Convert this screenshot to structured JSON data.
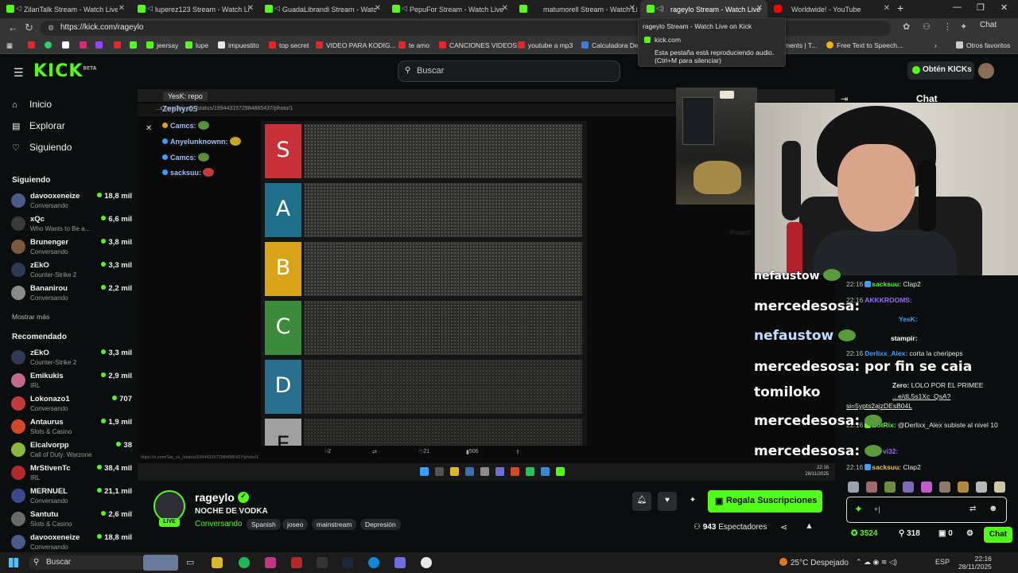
{
  "browser": {
    "tabs": [
      {
        "title": "ZilanTalk Stream - Watch Live",
        "favicon": "kick-icon",
        "muted": true
      },
      {
        "title": "luperez123 Stream - Watch Live",
        "favicon": "kick-icon",
        "muted": true
      },
      {
        "title": "GuadaLibrandi Stream - Watch Live",
        "favicon": "kick-icon",
        "muted": true
      },
      {
        "title": "PepuFor Stream - Watch Live",
        "favicon": "kick-icon",
        "muted": true
      },
      {
        "title": "matumorell Stream - Watch Live",
        "favicon": "kick-icon",
        "muted": false
      },
      {
        "title": "rageylo Stream - Watch Live",
        "favicon": "kick-icon",
        "muted": false,
        "active": true
      },
      {
        "title": "Worldwide! - YouTube",
        "favicon": "youtube-icon",
        "muted": false
      }
    ],
    "url": "https://kick.com/rageylo",
    "chat_button": "Chat",
    "bookmarks": [
      {
        "label": "jeersay",
        "color": "#53fc18"
      },
      {
        "label": "lupe",
        "color": "#53fc18"
      },
      {
        "label": "impuestito",
        "color": "#e6e6e6"
      },
      {
        "label": "top secret",
        "color": "#e8232a"
      },
      {
        "label": "VIDEO PARA KODIG...",
        "color": "#e8232a"
      },
      {
        "label": "te amo",
        "color": "#e8232a"
      },
      {
        "label": "CANCIONES VIDEOS",
        "color": "#e8232a"
      },
      {
        "label": "youtube a mp3",
        "color": "#e8232a"
      },
      {
        "label": "Calculadora De",
        "color": "#3b7ddd"
      },
      {
        "label": "ments | T...",
        "color": "#cccccc"
      },
      {
        "label": "Free Text to Speech...",
        "color": "#f2b400"
      },
      {
        "label": "Otros favoritos",
        "color": "#cccccc"
      }
    ],
    "tooltip": {
      "title": "rageylo Stream - Watch Live on Kick",
      "domain": "kick.com",
      "audio": "Esta pestaña está reproduciendo audio. (Ctrl+M para silenciar)"
    }
  },
  "kick": {
    "logo": "KICK",
    "logo_sup": "BETA",
    "search_placeholder": "Buscar",
    "kicks_button": "Obtén KICKs",
    "nav": [
      {
        "label": "Inicio",
        "icon": "home-icon"
      },
      {
        "label": "Explorar",
        "icon": "compass-icon"
      },
      {
        "label": "Siguiendo",
        "icon": "heart-icon"
      }
    ],
    "following_title": "Siguiendo",
    "following": [
      {
        "name": "davooxeneize",
        "category": "Conversando",
        "viewers": "18,8 mil",
        "color": "#4a5a8a"
      },
      {
        "name": "xQc",
        "category": "Who Wants to Be a...",
        "viewers": "6,6 mil",
        "color": "#3a3a3a"
      },
      {
        "name": "Brunenger",
        "category": "Conversando",
        "viewers": "3,8 mil",
        "color": "#7a5a3a"
      },
      {
        "name": "zEkO",
        "category": "Counter-Strike 2",
        "viewers": "3,3 mil",
        "color": "#2f3a52"
      },
      {
        "name": "Bananirou",
        "category": "Conversando",
        "viewers": "2,2 mil",
        "color": "#8a8a8a"
      }
    ],
    "show_more": "Mostrar más",
    "recommended_title": "Recomendado",
    "recommended": [
      {
        "name": "zEkO",
        "category": "Counter-Strike 2",
        "viewers": "3,3 mil",
        "color": "#2f3a52"
      },
      {
        "name": "Emikukis",
        "category": "IRL",
        "viewers": "2,9 mil",
        "color": "#c26a8a"
      },
      {
        "name": "Lokonazo1",
        "category": "Conversando",
        "viewers": "707",
        "color": "#c23a3a"
      },
      {
        "name": "Antaurus",
        "category": "Slots & Casino",
        "viewers": "1,9 mil",
        "color": "#d04a2a"
      },
      {
        "name": "Elcalvorpp",
        "category": "Call of Duty: Warzone",
        "viewers": "38",
        "color": "#8ab83a"
      },
      {
        "name": "MrStivenTc",
        "category": "IRL",
        "viewers": "38,4 mil",
        "color": "#b02a2a"
      },
      {
        "name": "MERNUEL",
        "category": "Conversando",
        "viewers": "21,1 mil",
        "color": "#3a4a8a"
      },
      {
        "name": "Santutu",
        "category": "Slots & Casino",
        "viewers": "2,6 mil",
        "color": "#6a6a6a"
      },
      {
        "name": "davooxeneize",
        "category": "Conversando",
        "viewers": "18,8 mil",
        "color": "#4a5a8a"
      }
    ]
  },
  "stream_content": {
    "overlay_chip": "YesK: repo",
    "overlay_user": "Zephyr05",
    "url_fragment": "...x.com/Sai_cs_/status/1994431572984885437/photo/1",
    "mini_chat": [
      {
        "user": "Camcs:"
      },
      {
        "user": "Anyelunknownn:"
      },
      {
        "user": "Camcs:"
      },
      {
        "user": "sacksuu:"
      }
    ],
    "tiers": [
      {
        "label": "S",
        "color": "#c8313a"
      },
      {
        "label": "A",
        "color": "#1f6f8a"
      },
      {
        "label": "B",
        "color": "#d9a319"
      },
      {
        "label": "C",
        "color": "#3c8a3c"
      },
      {
        "label": "D",
        "color": "#2a6f8f"
      },
      {
        "label": "E",
        "color": "#a0a0a0"
      }
    ],
    "actions": {
      "replies": "2",
      "likes": "21",
      "views": "506"
    },
    "status_url": "https://x.com/Sai_cs_/status/1994431572984885437/photo/1",
    "inner_clock": {
      "time": "22:16",
      "date": "28/11/2025"
    },
    "ghost_text": "Posted"
  },
  "chat": {
    "title": "Chat",
    "messages": [
      {
        "time": "22:16",
        "user": "sacksuu:",
        "text": "Clap2",
        "user_color": "#53fc18"
      },
      {
        "time": "22:16",
        "user": "AKKKROOMS:",
        "text": "",
        "user_color": "#9b6bff"
      },
      {
        "time": "",
        "user": "YesK:",
        "text": "",
        "user_color": "#3aa0ff"
      },
      {
        "time": "",
        "user": "stampir:",
        "text": "",
        "user_color": "#ffffff"
      },
      {
        "time": "22:16",
        "user": "Derlixx_Alex:",
        "text": "corta la cheripeps",
        "user_color": "#3aa0ff"
      },
      {
        "time": "",
        "user": "Zero:",
        "text": "LOLO POR EL PRIMEE",
        "user_color": "#ffffff"
      },
      {
        "time": "",
        "user": "",
        "text": "...e/dL5s1Xc_QsA?",
        "user_color": "#ffffff"
      },
      {
        "time": "",
        "user": "",
        "text": "si=5ypts2ajzDEsB04L",
        "user_color": "#ffffff"
      },
      {
        "time": "22:16",
        "user": "BotRix:",
        "text": "@Derlixx_Alex subiste al nivel 10",
        "user_color": "#53fc18"
      },
      {
        "time": "",
        "user": "vi32:",
        "text": "",
        "user_color": "#9b6bff"
      },
      {
        "time": "22:16",
        "user": "sacksuu:",
        "text": "Clap2",
        "user_color": "#e8c32a"
      }
    ],
    "big_overlay": [
      {
        "user": "nefaustow",
        "text": ""
      },
      {
        "user": "mercedesosa:",
        "text": ""
      },
      {
        "user": "nefaustow",
        "text": ""
      },
      {
        "user": "mercedesosa:",
        "text": "por fin se caia"
      },
      {
        "user": "tomiloko",
        "text": ""
      },
      {
        "user": "mercedesosa:",
        "text": ""
      },
      {
        "user": "mercedesosa:",
        "text": ""
      }
    ],
    "input_value": "+|",
    "points": "3524",
    "gifts": "318",
    "drops": "0",
    "send_label": "Chat"
  },
  "channel": {
    "name": "rageylo",
    "title": "NOCHE DE VODKA",
    "category": "Conversando",
    "tags": [
      "Spanish",
      "joseo",
      "mainstream",
      "Depresión"
    ],
    "live_label": "LIVE",
    "subscribe_label": "Regala Suscripciones",
    "viewers": "943",
    "viewers_label": "Espectadores"
  },
  "taskbar": {
    "search": "Buscar",
    "weather": "25°C  Despejado",
    "lang": "ESP",
    "time": "22:16",
    "date": "28/11/2025"
  }
}
